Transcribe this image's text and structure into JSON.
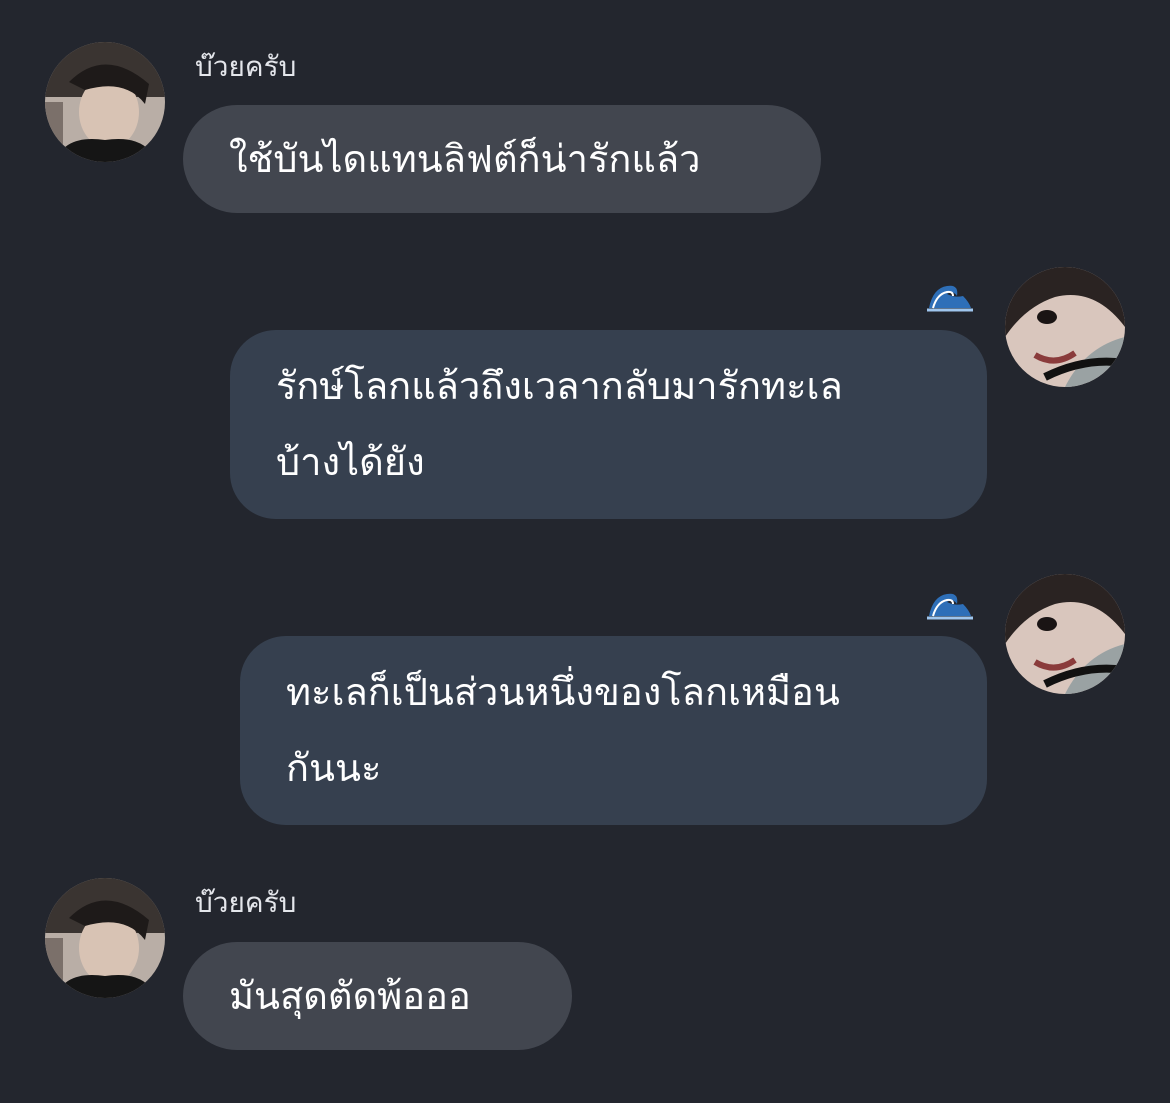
{
  "messages": [
    {
      "direction": "incoming",
      "sender": "บ๊วยครับ",
      "avatar_icon": "profile-photo-avatar",
      "lines": [
        "ใช้บันไดแทนลิฟต์ก็น่ารักแล้ว"
      ]
    },
    {
      "direction": "outgoing",
      "reaction_icon": "🌊",
      "avatar_icon": "profile-photo-avatar",
      "lines": [
        "รักษ์โลกแล้วถึงเวลากลับมารักทะเล",
        "บ้างได้ยัง"
      ]
    },
    {
      "direction": "outgoing",
      "reaction_icon": "🌊",
      "avatar_icon": "profile-photo-avatar",
      "lines": [
        "ทะเลก็เป็นส่วนหนึ่งของโลกเหมือน",
        "กันนะ"
      ]
    },
    {
      "direction": "incoming",
      "sender": "บ๊วยครับ",
      "avatar_icon": "profile-photo-avatar",
      "lines": [
        "มันสุดตัดพ้อออ"
      ]
    }
  ],
  "colors": {
    "background": "#23262e",
    "incoming_bubble": "#42464f",
    "outgoing_bubble": "#36404f",
    "sender_name": "#e4e6eb"
  }
}
